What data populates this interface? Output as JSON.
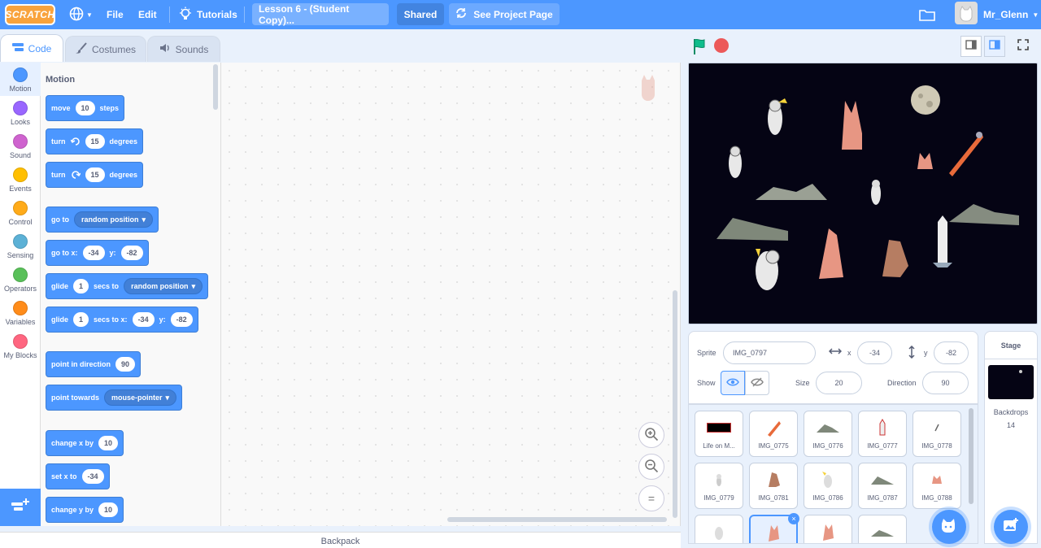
{
  "menubar": {
    "logo": "SCRATCH",
    "file": "File",
    "edit": "Edit",
    "tutorials": "Tutorials",
    "project_title": "Lesson 6 - (Student Copy)...",
    "shared": "Shared",
    "see_project_page": "See Project Page",
    "username": "Mr_Glenn"
  },
  "tabs": {
    "code": "Code",
    "costumes": "Costumes",
    "sounds": "Sounds"
  },
  "categories": [
    {
      "label": "Motion",
      "color": "#4c97ff"
    },
    {
      "label": "Looks",
      "color": "#9966ff"
    },
    {
      "label": "Sound",
      "color": "#cf63cf"
    },
    {
      "label": "Events",
      "color": "#ffbf00"
    },
    {
      "label": "Control",
      "color": "#ffab19"
    },
    {
      "label": "Sensing",
      "color": "#5cb1d6"
    },
    {
      "label": "Operators",
      "color": "#59c059"
    },
    {
      "label": "Variables",
      "color": "#ff8c1a"
    },
    {
      "label": "My Blocks",
      "color": "#ff6680"
    }
  ],
  "palette": {
    "title": "Motion",
    "move": {
      "a": "move",
      "v": "10",
      "b": "steps"
    },
    "turn_right": {
      "a": "turn",
      "v": "15",
      "b": "degrees"
    },
    "turn_left": {
      "a": "turn",
      "v": "15",
      "b": "degrees"
    },
    "goto": {
      "a": "go to",
      "dd": "random position"
    },
    "gotoxy": {
      "a": "go to x:",
      "x": "-34",
      "y_label": "y:",
      "y": "-82"
    },
    "glide_to": {
      "a": "glide",
      "v": "1",
      "b": "secs to",
      "dd": "random position"
    },
    "glide_xy": {
      "a": "glide",
      "v": "1",
      "b": "secs to x:",
      "x": "-34",
      "y_label": "y:",
      "y": "-82"
    },
    "point_dir": {
      "a": "point in direction",
      "v": "90"
    },
    "point_towards": {
      "a": "point towards",
      "dd": "mouse-pointer"
    },
    "change_x": {
      "a": "change x by",
      "v": "10"
    },
    "set_x": {
      "a": "set x to",
      "v": "-34"
    },
    "change_y": {
      "a": "change y by",
      "v": "10"
    }
  },
  "backpack": "Backpack",
  "sprite_info": {
    "sprite_label": "Sprite",
    "sprite_name": "IMG_0797",
    "x_label": "x",
    "x": "-34",
    "y_label": "y",
    "y": "-82",
    "show_label": "Show",
    "size_label": "Size",
    "size": "20",
    "direction_label": "Direction",
    "direction": "90"
  },
  "sprites": [
    {
      "name": "Life on M..."
    },
    {
      "name": "IMG_0775"
    },
    {
      "name": "IMG_0776"
    },
    {
      "name": "IMG_0777"
    },
    {
      "name": "IMG_0778"
    },
    {
      "name": "IMG_0779"
    },
    {
      "name": "IMG_0781"
    },
    {
      "name": "IMG_0786"
    },
    {
      "name": "IMG_0787"
    },
    {
      "name": "IMG_0788"
    }
  ],
  "stage_panel": {
    "title": "Stage",
    "backdrops_label": "Backdrops",
    "backdrops_count": "14"
  },
  "colors": {
    "accent": "#4c97ff",
    "stage_bg": "#050414",
    "stop": "#ec5959",
    "flag": "#0fbd8c"
  }
}
